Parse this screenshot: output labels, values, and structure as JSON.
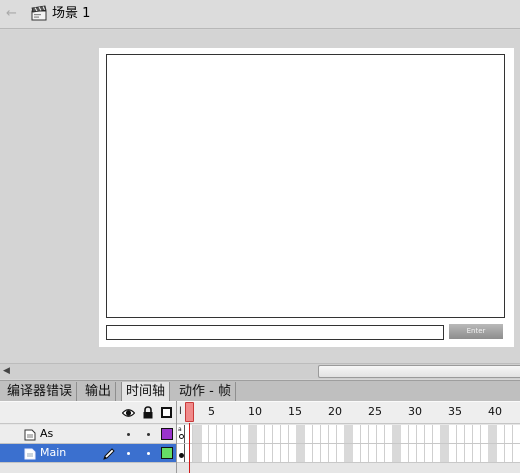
{
  "scene": {
    "title": "场景 1"
  },
  "stage": {
    "button_label": "Enter"
  },
  "tabs": [
    {
      "label": "编译器错误"
    },
    {
      "label": "输出"
    },
    {
      "label": "时间轴"
    },
    {
      "label": "动作 - 帧"
    }
  ],
  "timeline": {
    "first_frame_marker": "l",
    "frame_numbers": [
      "5",
      "10",
      "15",
      "20",
      "25",
      "30",
      "35",
      "40"
    ],
    "current_frame": 1,
    "layers": [
      {
        "name": "As",
        "color": "#9933cc",
        "selected": false
      },
      {
        "name": "Main",
        "color": "#66dd66",
        "selected": true
      }
    ]
  },
  "colors": {
    "selection": "#3b70cf",
    "playhead": "#d01818"
  }
}
